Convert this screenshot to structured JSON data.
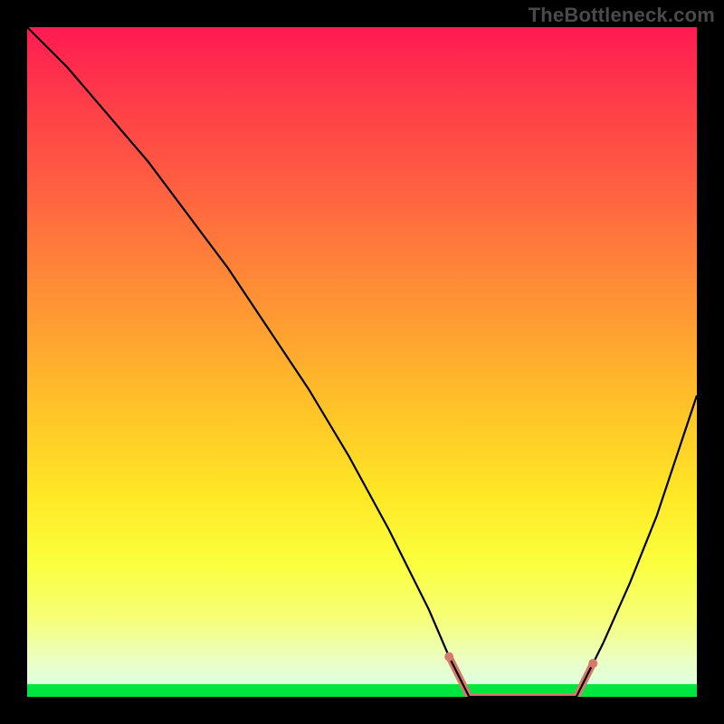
{
  "watermark": "TheBottleneck.com",
  "chart_data": {
    "type": "line",
    "title": "",
    "xlabel": "",
    "ylabel": "",
    "xlim": [
      0,
      100
    ],
    "ylim": [
      0,
      100
    ],
    "grid": false,
    "legend": false,
    "background": "heatmap-gradient",
    "gradient_stops": [
      {
        "pos": 0,
        "color": "#ff1a52"
      },
      {
        "pos": 22,
        "color": "#ff5a42"
      },
      {
        "pos": 46,
        "color": "#ffa230"
      },
      {
        "pos": 70,
        "color": "#ffe826"
      },
      {
        "pos": 88,
        "color": "#f6ff75"
      },
      {
        "pos": 100,
        "color": "#00e640"
      }
    ],
    "series": [
      {
        "name": "bottleneck-curve-left",
        "x": [
          0,
          6,
          12,
          18,
          24,
          30,
          36,
          42,
          48,
          54,
          60,
          63,
          66
        ],
        "y": [
          100,
          94,
          87,
          80,
          72,
          64,
          55,
          46,
          36,
          25,
          13,
          6,
          0
        ]
      },
      {
        "name": "bottleneck-curve-floor",
        "x": [
          66,
          70,
          74,
          78,
          82
        ],
        "y": [
          0,
          0,
          0,
          0,
          0
        ]
      },
      {
        "name": "bottleneck-curve-right",
        "x": [
          82,
          86,
          90,
          94,
          97,
          100
        ],
        "y": [
          0,
          8,
          17,
          27,
          36,
          45
        ]
      }
    ],
    "highlight_segments": [
      {
        "name": "optimal-range-left-descent",
        "x": [
          63,
          66
        ],
        "y": [
          6,
          0
        ]
      },
      {
        "name": "optimal-range-floor",
        "x": [
          66,
          70,
          74,
          78,
          82
        ],
        "y": [
          0,
          0,
          0,
          0,
          0
        ]
      },
      {
        "name": "optimal-range-right-ascent",
        "x": [
          82,
          84.5
        ],
        "y": [
          0,
          5
        ]
      }
    ],
    "highlight_dots": [
      {
        "x": 63,
        "y": 6
      },
      {
        "x": 84.5,
        "y": 5
      }
    ]
  }
}
